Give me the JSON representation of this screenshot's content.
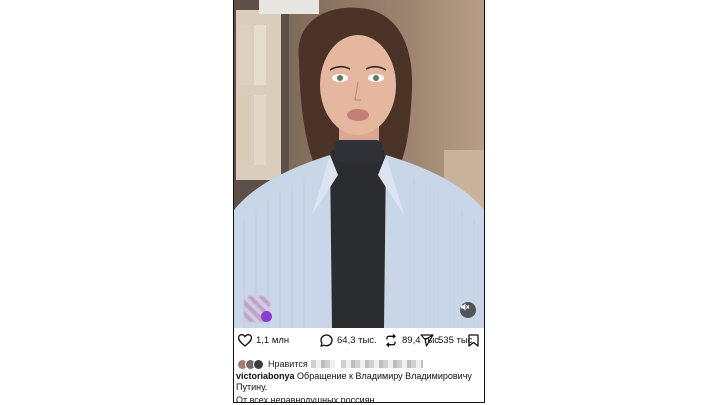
{
  "post": {
    "stats": {
      "likes": "1,1 млн",
      "comments": "64,3 тыс.",
      "reposts": "89,4 тыс.",
      "shares": "535 тыс."
    },
    "liked_by_label": "Нравится",
    "username": "victoriabonya",
    "caption": "Обращение к Владимиру Владимировичу Путину.",
    "caption_line2": "От всех неравнодушных россиян."
  },
  "icons": {
    "like": "heart-icon",
    "comment": "comment-bubble-icon",
    "repost": "repost-arrows-icon",
    "share": "send-paper-plane-icon",
    "save": "bookmark-icon",
    "mute": "speaker-muted-icon"
  },
  "colors": {
    "shirt": "#c9d6e8",
    "turtleneck": "#2a2c30",
    "badge": "#8b3fd1"
  }
}
